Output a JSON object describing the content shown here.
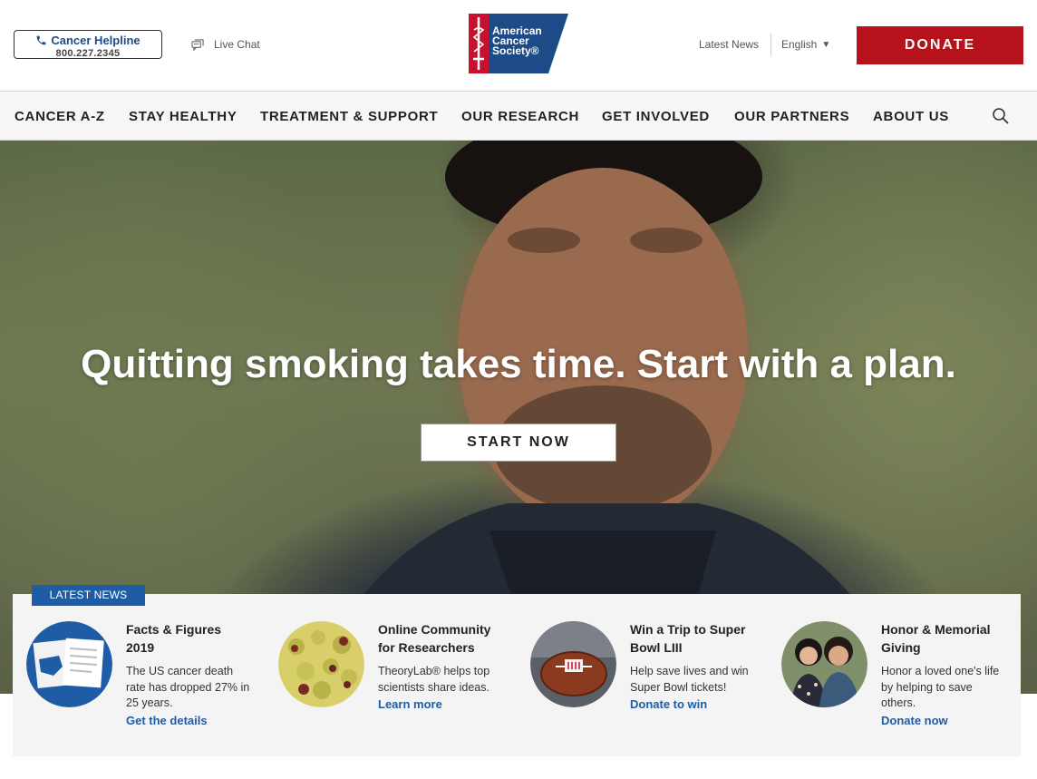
{
  "header": {
    "helpline": {
      "title": "Cancer Helpline",
      "number": "800.227.2345"
    },
    "live_chat": "Live Chat",
    "logo": {
      "line1": "American",
      "line2": "Cancer",
      "line3": "Society®"
    },
    "latest_news": "Latest News",
    "language": "English",
    "donate": "DONATE",
    "colors": {
      "brand_blue": "#1d4b87",
      "donate_red": "#b5121b"
    }
  },
  "nav": {
    "items": [
      "CANCER A-Z",
      "STAY HEALTHY",
      "TREATMENT & SUPPORT",
      "OUR RESEARCH",
      "GET INVOLVED",
      "OUR PARTNERS",
      "ABOUT US"
    ],
    "search_icon": "search-icon"
  },
  "hero": {
    "headline": "Quitting smoking takes time. Start with a plan.",
    "cta": "START NOW"
  },
  "news": {
    "tag": "LATEST NEWS",
    "cards": [
      {
        "title": "Facts & Figures 2019",
        "desc": "The US cancer death rate has dropped 27% in 25 years.",
        "link": "Get the details"
      },
      {
        "title": "Online Community for Researchers",
        "desc": "TheoryLab® helps top scientists share ideas.",
        "link": "Learn more"
      },
      {
        "title": "Win a Trip to Super Bowl LIII",
        "desc": "Help save lives and win Super Bowl tickets!",
        "link": "Donate to win"
      },
      {
        "title": "Honor & Memorial Giving",
        "desc": "Honor a loved one's life by helping to save others.",
        "link": "Donate now"
      }
    ]
  }
}
